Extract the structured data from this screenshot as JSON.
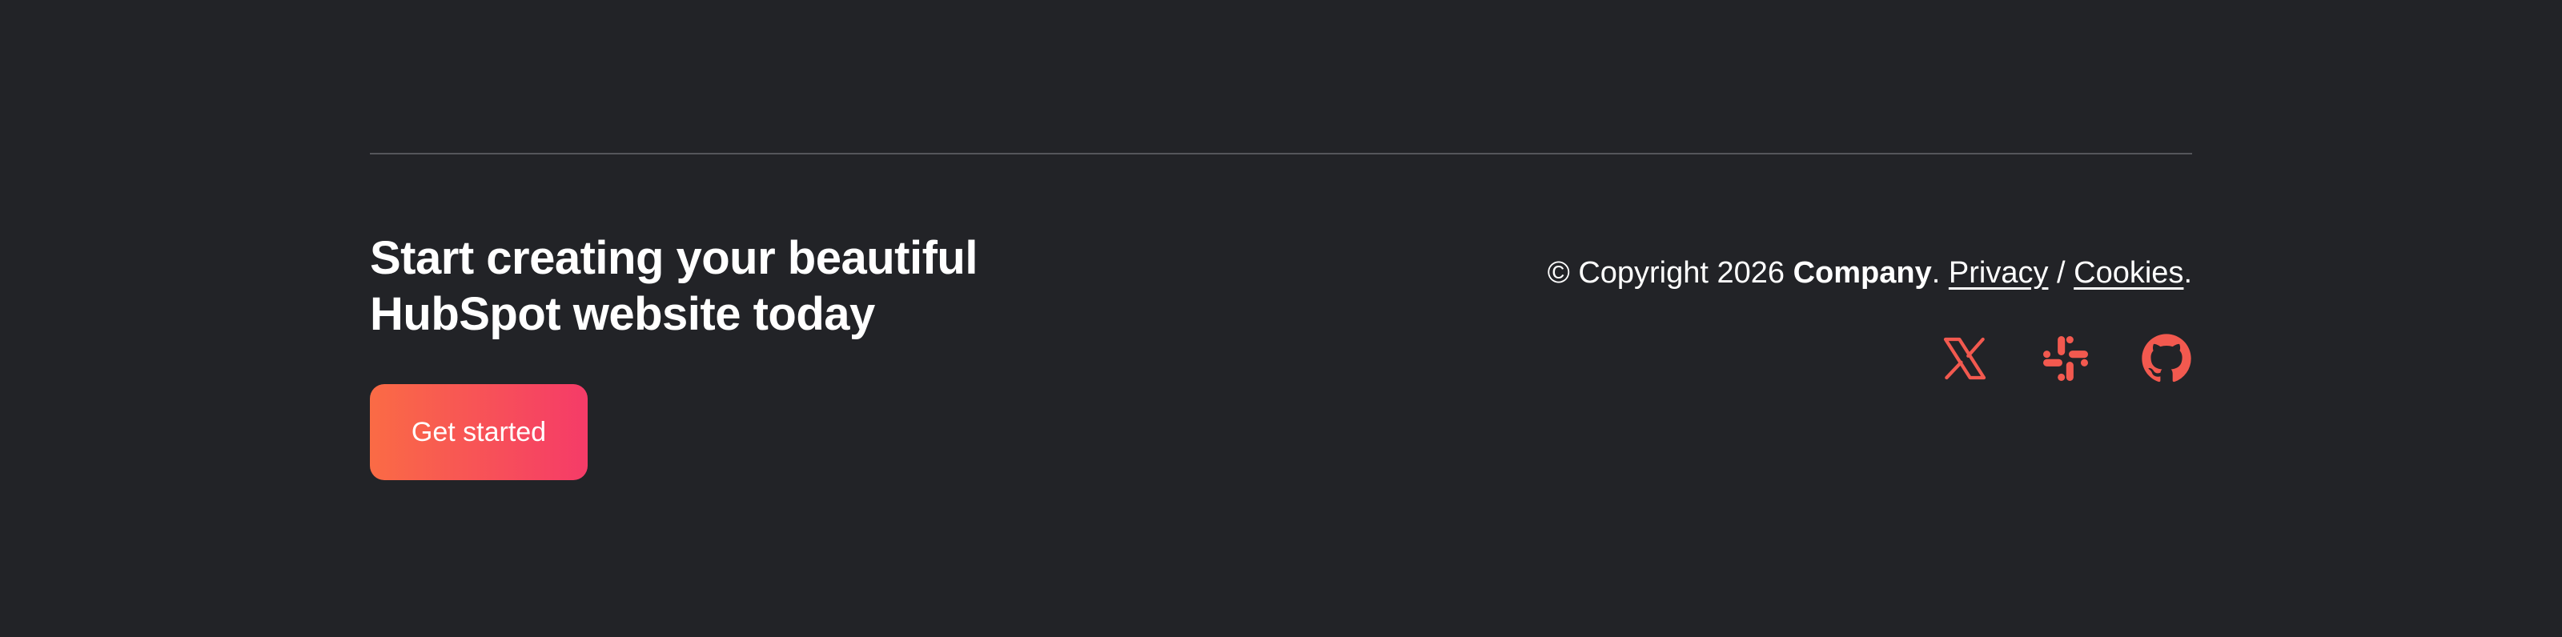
{
  "cta": {
    "title_line1": "Start creating your beautiful",
    "title_line2": "HubSpot website today",
    "button_label": "Get started",
    "button_gradient": [
      "#fa6b45",
      "#f53b68"
    ]
  },
  "legal": {
    "copyright_prefix": "© Copyright 2026 ",
    "company": "Company",
    "sep1": ". ",
    "privacy_label": "Privacy",
    "slash": " / ",
    "cookies_label": "Cookies",
    "end": "."
  },
  "socials": [
    {
      "icon": "x-twitter-icon",
      "color": "#f2594f"
    },
    {
      "icon": "slack-icon",
      "color": "#f2594f"
    },
    {
      "icon": "github-icon",
      "color": "#f2594f"
    }
  ],
  "colors": {
    "background": "#222327",
    "divider": "#55565b",
    "accent": "#f2594f"
  }
}
